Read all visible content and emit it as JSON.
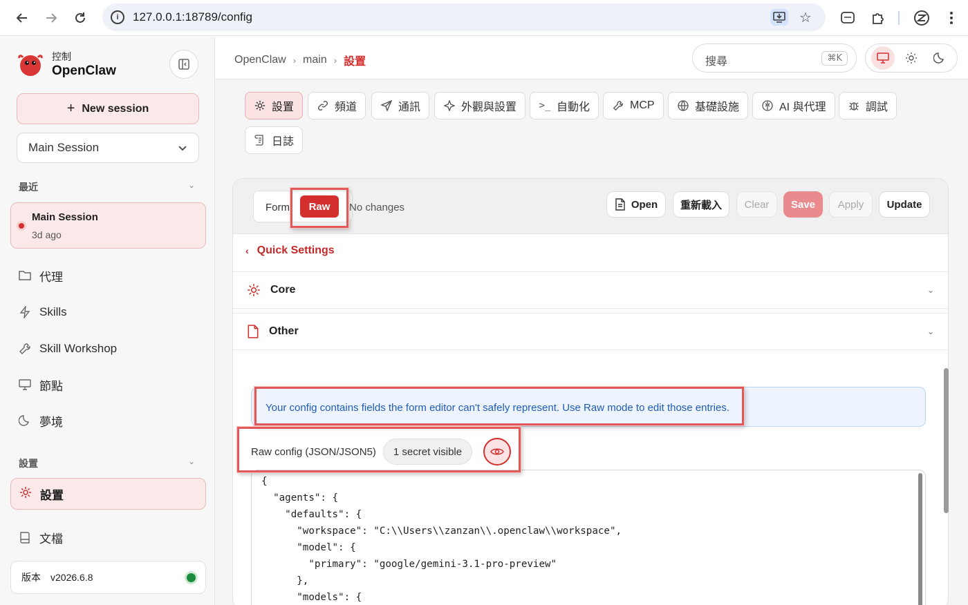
{
  "browser": {
    "url": "127.0.0.1:18789/config"
  },
  "sidebar": {
    "brand_sub": "控制",
    "brand_title": "OpenClaw",
    "new_session_label": "New session",
    "session_select": "Main Session",
    "recent_label": "最近",
    "recent_item": {
      "title": "Main Session",
      "time": "3d ago"
    },
    "nav": [
      "代理",
      "Skills",
      "Skill Workshop",
      "節點",
      "夢境"
    ],
    "settings_section_label": "設置",
    "active_item": "設置",
    "docs_label": "文檔",
    "version_label": "版本",
    "version_value": "v2026.6.8"
  },
  "topbar": {
    "breadcrumbs": [
      "OpenClaw",
      "main",
      "設置"
    ],
    "search_placeholder": "搜尋",
    "search_shortcut": "⌘K"
  },
  "tabs": [
    "設置",
    "頻道",
    "通訊",
    "外觀與設置",
    "自動化",
    "MCP",
    "基礎設施",
    "AI 與代理",
    "調試",
    "日誌"
  ],
  "editor": {
    "mode_form": "Form",
    "mode_raw": "Raw",
    "status": "No changes",
    "buttons": {
      "open": "Open",
      "reload": "重新載入",
      "clear": "Clear",
      "save": "Save",
      "apply": "Apply",
      "update": "Update"
    },
    "quick_settings": "Quick Settings",
    "sections": [
      "Core",
      "Other"
    ],
    "notice": "Your config contains fields the form editor can't safely represent. Use Raw mode to edit those entries.",
    "raw_label": "Raw config (JSON/JSON5)",
    "secret_badge": "1 secret visible",
    "code_lines": [
      "{",
      "  \"agents\": {",
      "    \"defaults\": {",
      "      \"workspace\": \"C:\\\\Users\\\\zanzan\\\\.openclaw\\\\workspace\",",
      "      \"model\": {",
      "        \"primary\": \"google/gemini-3.1-pro-preview\"",
      "      },",
      "      \"models\": {"
    ]
  },
  "colors": {
    "accent": "#d32f2f",
    "accent_soft": "#fbe9ea",
    "info_text": "#1e5bb8",
    "status_ok": "#1e8e3e"
  }
}
